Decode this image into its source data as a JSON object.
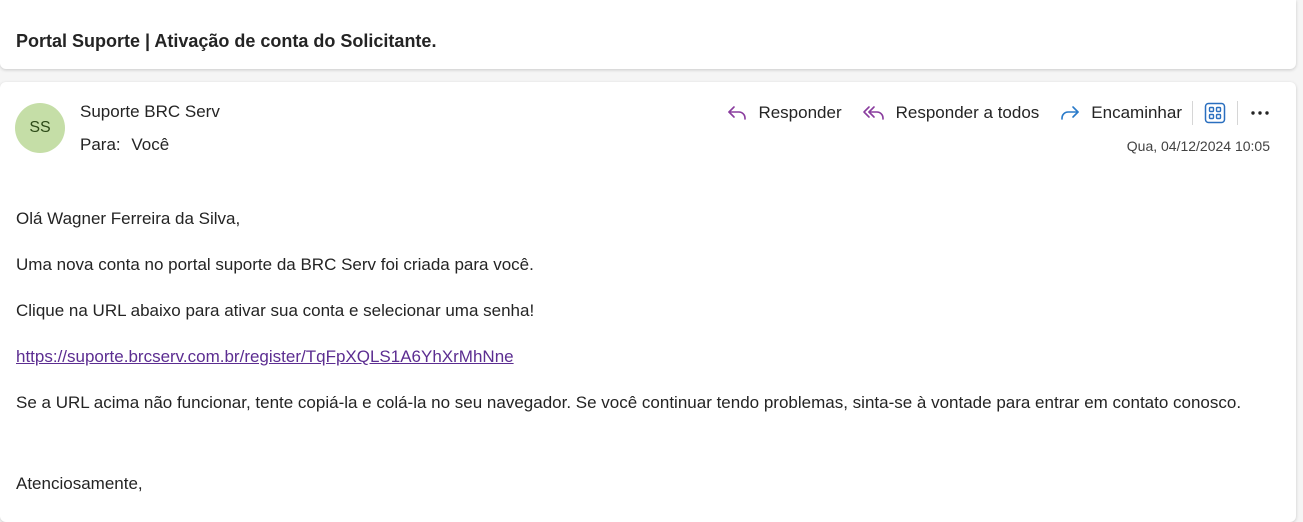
{
  "email": {
    "subject": "Portal Suporte | Ativação de conta do Solicitante.",
    "avatar_initials": "SS",
    "avatar_color": "#c5dea7",
    "sender_name": "Suporte BRC Serv",
    "to_label": "Para:",
    "to_value": "Você",
    "date": "Qua, 04/12/2024 10:05"
  },
  "actions": {
    "reply": {
      "label": "Responder",
      "icon": "reply-icon"
    },
    "reply_all": {
      "label": "Responder a todos",
      "icon": "reply-all-icon"
    },
    "forward": {
      "label": "Encaminhar",
      "icon": "forward-icon"
    },
    "apps": {
      "icon": "apps-icon"
    },
    "more": {
      "icon": "more-icon"
    }
  },
  "body": {
    "greeting": "Olá Wagner Ferreira da Silva,",
    "line1": "Uma nova conta no portal suporte da BRC Serv foi criada para você.",
    "line2": "Clique na URL abaixo para ativar sua conta e selecionar uma senha!",
    "link": "https://suporte.brcserv.com.br/register/TqFpXQLS1A6YhXrMhNne",
    "line3": "Se a URL acima não funcionar, tente copiá-la e colá-la no seu navegador. Se você continuar tendo problemas, sinta-se à vontade para entrar em contato conosco.",
    "closing": "Atenciosamente,"
  },
  "colors": {
    "reply_icon": "#8a3d9e",
    "forward_icon": "#2a7ac9",
    "apps_icon": "#2a6fbf",
    "link": "#5c2d91"
  }
}
